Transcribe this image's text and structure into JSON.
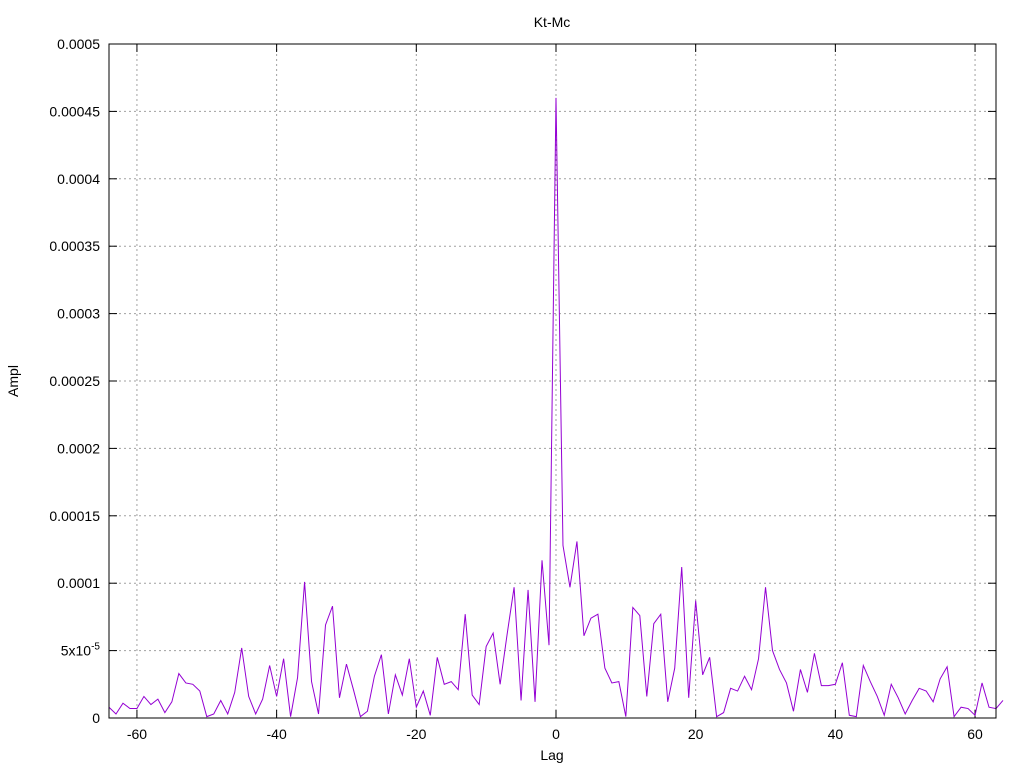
{
  "chart_data": {
    "type": "line",
    "title": "Kt-Mc",
    "xlabel": "Lag",
    "ylabel": "Ampl",
    "xlim": [
      -64,
      63
    ],
    "ylim": [
      0,
      0.0005
    ],
    "grid": true,
    "line_color": "#9400d3",
    "x_ticks": [
      {
        "value": -60,
        "label": "-60"
      },
      {
        "value": -40,
        "label": "-40"
      },
      {
        "value": -20,
        "label": "-20"
      },
      {
        "value": 0,
        "label": "0"
      },
      {
        "value": 20,
        "label": "20"
      },
      {
        "value": 40,
        "label": "40"
      },
      {
        "value": 60,
        "label": "60"
      }
    ],
    "y_ticks": [
      {
        "value": 0,
        "label": "0"
      },
      {
        "value": 5e-05,
        "label": "5x10",
        "sup": "-5"
      },
      {
        "value": 0.0001,
        "label": "0.0001"
      },
      {
        "value": 0.00015,
        "label": "0.00015"
      },
      {
        "value": 0.0002,
        "label": "0.0002"
      },
      {
        "value": 0.00025,
        "label": "0.00025"
      },
      {
        "value": 0.0003,
        "label": "0.0003"
      },
      {
        "value": 0.00035,
        "label": "0.00035"
      },
      {
        "value": 0.0004,
        "label": "0.0004"
      },
      {
        "value": 0.00045,
        "label": "0.00045"
      },
      {
        "value": 0.0005,
        "label": "0.0005"
      }
    ],
    "series": [
      {
        "x_start": -64,
        "x_step": 1,
        "values": [
          8e-06,
          3e-06,
          1.1e-05,
          7e-06,
          7e-06,
          1.6e-05,
          1e-05,
          1.4e-05,
          4e-06,
          1.2e-05,
          3.3e-05,
          2.6e-05,
          2.5e-05,
          2e-05,
          1e-06,
          3e-06,
          1.3e-05,
          3e-06,
          1.9e-05,
          5.2e-05,
          1.6e-05,
          3e-06,
          1.4e-05,
          3.9e-05,
          1.6e-05,
          4.4e-05,
          1e-06,
          3e-05,
          0.000101,
          2.7e-05,
          3e-06,
          6.9e-05,
          8.3e-05,
          1.5e-05,
          4e-05,
          2.1e-05,
          1e-06,
          5e-06,
          3.1e-05,
          4.7e-05,
          3e-06,
          3.2e-05,
          1.7e-05,
          4.4e-05,
          8e-06,
          2e-05,
          2e-06,
          4.5e-05,
          2.5e-05,
          2.7e-05,
          2.1e-05,
          7.7e-05,
          1.7e-05,
          1e-05,
          5.3e-05,
          6.3e-05,
          2.5e-05,
          6.2e-05,
          9.7e-05,
          1.3e-05,
          9.5e-05,
          1.2e-05,
          0.000117,
          5.4e-05,
          0.00046,
          0.000128,
          9.7e-05,
          0.000131,
          6.1e-05,
          7.4e-05,
          7.7e-05,
          3.7e-05,
          2.6e-05,
          2.7e-05,
          1e-06,
          8.2e-05,
          7.6e-05,
          1.6e-05,
          7e-05,
          7.7e-05,
          1.2e-05,
          3.7e-05,
          0.000112,
          1.5e-05,
          8.7e-05,
          3.2e-05,
          4.5e-05,
          1e-06,
          4e-06,
          2.2e-05,
          2e-05,
          3.1e-05,
          2.1e-05,
          4.4e-05,
          9.7e-05,
          5e-05,
          3.6e-05,
          2.6e-05,
          5e-06,
          3.6e-05,
          1.9e-05,
          4.8e-05,
          2.4e-05,
          2.4e-05,
          2.5e-05,
          4.1e-05,
          2e-06,
          1e-06,
          3.9e-05,
          2.7e-05,
          1.6e-05,
          2e-06,
          2.5e-05,
          1.5e-05,
          3e-06,
          1.3e-05,
          2.2e-05,
          2e-05,
          1.2e-05,
          2.9e-05,
          3.8e-05,
          1e-06,
          8e-06,
          7e-06,
          2e-06,
          2.6e-05,
          8e-06,
          7e-06,
          1.3e-05
        ]
      }
    ]
  }
}
